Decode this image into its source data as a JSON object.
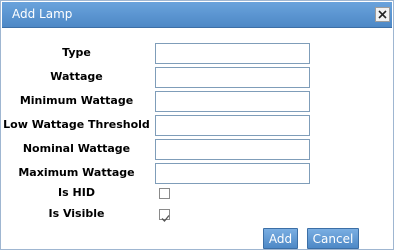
{
  "dialog": {
    "title": "Add Lamp",
    "close_glyph": "×"
  },
  "fields": [
    {
      "label": "Type",
      "value": "",
      "type": "text"
    },
    {
      "label": "Wattage",
      "value": "",
      "type": "text"
    },
    {
      "label": "Minimum Wattage",
      "value": "",
      "type": "text"
    },
    {
      "label": "Low Wattage Threshold",
      "value": "",
      "type": "text"
    },
    {
      "label": "Nominal Wattage",
      "value": "",
      "type": "text"
    },
    {
      "label": "Maximum Wattage",
      "value": "",
      "type": "text"
    },
    {
      "label": "Is HID",
      "checked": false,
      "type": "checkbox"
    },
    {
      "label": "Is Visible",
      "checked": true,
      "type": "checkbox"
    }
  ],
  "buttons": {
    "add_label": "Add",
    "cancel_label": "Cancel"
  },
  "colors": {
    "titlebar": "#5a94d0",
    "button": "#5a94d0",
    "input_border": "#7f9db9"
  },
  "icons": {
    "close": "close-icon",
    "check": "checkmark-icon"
  }
}
